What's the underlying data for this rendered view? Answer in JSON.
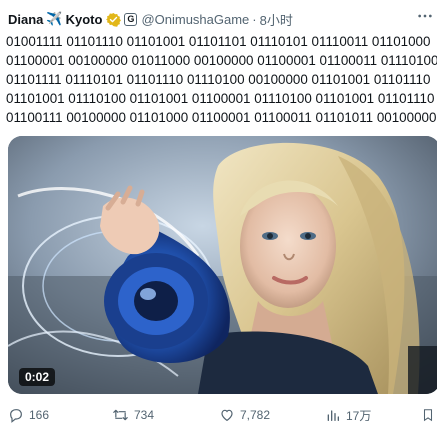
{
  "tweet": {
    "display_name": "Diana",
    "name_emoji": "✈️",
    "name_suffix": "Kyoto",
    "affiliate_badge": "G",
    "handle": "@OnimushaGame",
    "separator": "·",
    "time": "8小时",
    "more_icon": "more-icon",
    "text_lines": [
      "01001111 01101110 01101001 01101101 01110101 01110011 01101000",
      "01100001 00100000 01011000 00100000 01100001 01100011 01110100",
      "01101111 01110101 01101110 01110100 00100000 01101001 01101110",
      "01101001 01110100 01101001 01100001 01110100 01101001 01101110",
      "01100111 00100000 01101000 01100001 01100011 01101011 00100000"
    ],
    "video": {
      "duration": "0:02"
    },
    "actions": {
      "replies": "166",
      "reposts": "734",
      "likes": "7,782",
      "views": "17万"
    },
    "colors": {
      "verified_gold": "#e2b719",
      "icon_gray": "#536471",
      "video_overlay": "#000000"
    }
  }
}
